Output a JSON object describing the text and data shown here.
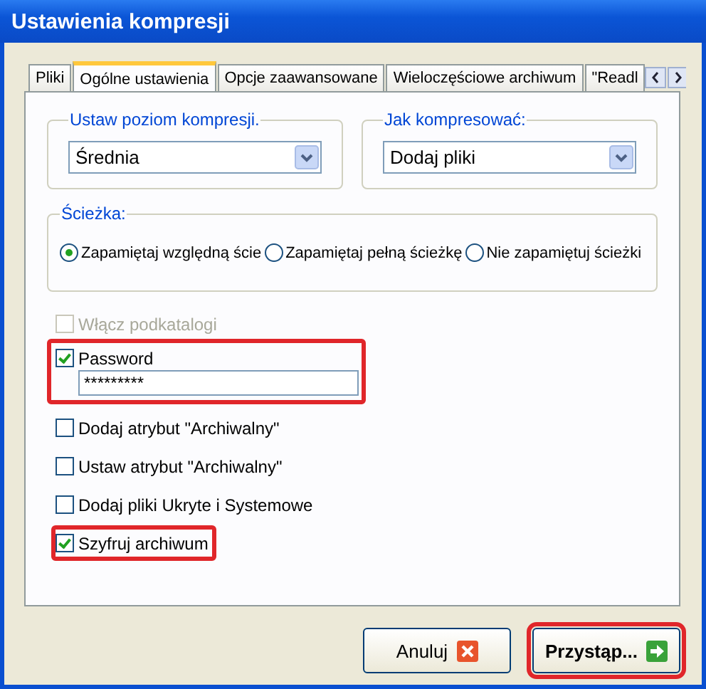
{
  "window": {
    "title": "Ustawienia kompresji"
  },
  "tabs": [
    {
      "label": "Pliki",
      "selected": false
    },
    {
      "label": "Ogólne ustawienia",
      "selected": true
    },
    {
      "label": "Opcje zaawansowane",
      "selected": false
    },
    {
      "label": "Wieloczęściowe archiwum",
      "selected": false
    },
    {
      "label": "\"Readl",
      "selected": false
    }
  ],
  "level_group": {
    "legend": "Ustaw poziom kompresji.",
    "value": "Średnia"
  },
  "method_group": {
    "legend": "Jak kompresować:",
    "value": "Dodaj pliki"
  },
  "path_group": {
    "legend": "Ścieżka:",
    "options": [
      {
        "label": "Zapamiętaj względną ście",
        "selected": true
      },
      {
        "label": "Zapamiętaj pełną ścieżkę",
        "selected": false
      },
      {
        "label": "Nie zapamiętuj ścieżki",
        "selected": false
      }
    ]
  },
  "subfolders": {
    "label": "Włącz podkatalogi",
    "checked": false,
    "disabled": true
  },
  "password": {
    "label": "Password",
    "checked": true,
    "value": "*********",
    "highlighted": true
  },
  "options": [
    {
      "label": "Dodaj atrybut \"Archiwalny\"",
      "checked": false,
      "highlighted": false
    },
    {
      "label": "Ustaw atrybut \"Archiwalny\"",
      "checked": false,
      "highlighted": false
    },
    {
      "label": "Dodaj pliki Ukryte i Systemowe",
      "checked": false,
      "highlighted": false
    },
    {
      "label": "Szyfruj archiwum",
      "checked": true,
      "highlighted": true
    }
  ],
  "buttons": [
    {
      "label": "Anuluj",
      "kind": "cancel",
      "highlighted": false
    },
    {
      "label": "Przystąp...",
      "kind": "proceed",
      "highlighted": true
    }
  ]
}
